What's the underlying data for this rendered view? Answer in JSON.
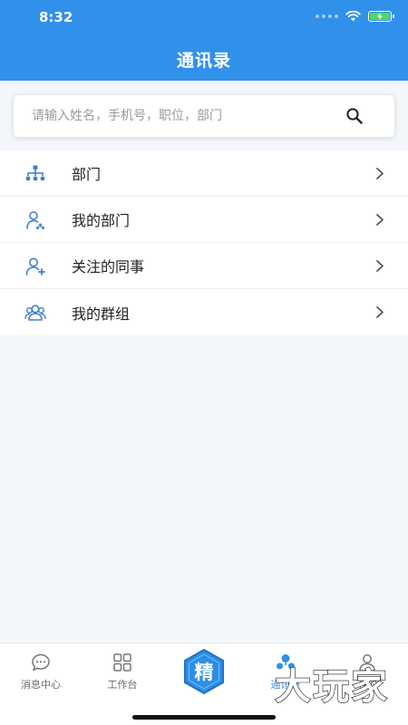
{
  "status_bar": {
    "time": "8:32"
  },
  "header": {
    "title": "通讯录"
  },
  "search": {
    "placeholder": "请输入姓名，手机号，职位，部门"
  },
  "menu": {
    "items": [
      {
        "label": "部门",
        "icon": "org-chart-icon"
      },
      {
        "label": "我的部门",
        "icon": "user-group-badge-icon"
      },
      {
        "label": "关注的同事",
        "icon": "user-add-icon"
      },
      {
        "label": "我的群组",
        "icon": "users-group-icon"
      }
    ]
  },
  "tabbar": {
    "tabs": [
      {
        "label": "消息中心",
        "icon": "chat-bubble-icon",
        "active": false
      },
      {
        "label": "工作台",
        "icon": "grid-icon",
        "active": false
      },
      {
        "label": "精",
        "icon": "hexagon-logo-icon",
        "active": false
      },
      {
        "label": "通讯录",
        "icon": "contacts-icon",
        "active": true
      },
      {
        "label": "我的",
        "icon": "profile-icon",
        "active": false
      }
    ]
  },
  "watermark": {
    "text": "大玩家"
  },
  "colors": {
    "primary": "#3190ea",
    "icon_blue": "#3f7fcf",
    "battery_green": "#4cd964"
  }
}
